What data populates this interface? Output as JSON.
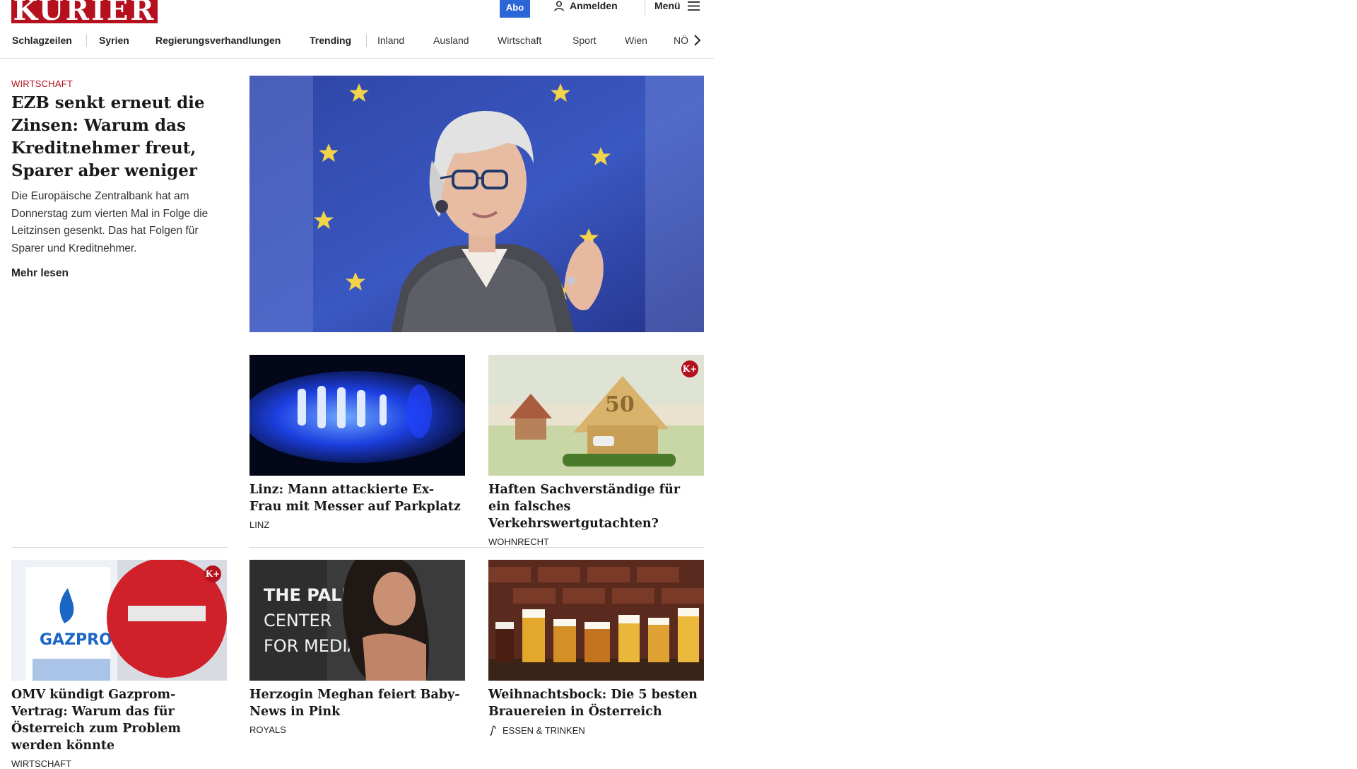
{
  "header": {
    "logo": "KURIER",
    "abo_label": "Abo",
    "login_label": "Anmelden",
    "menu_label": "Menü"
  },
  "nav": {
    "items": [
      {
        "label": "Schlagzeilen"
      },
      {
        "label": "Syrien"
      },
      {
        "label": "Regierungsverhandlungen"
      },
      {
        "label": "Trending"
      },
      {
        "label": "Inland"
      },
      {
        "label": "Ausland"
      },
      {
        "label": "Wirtschaft"
      },
      {
        "label": "Sport"
      },
      {
        "label": "Wien"
      },
      {
        "label": "NÖ"
      }
    ]
  },
  "lead": {
    "kicker": "WIRTSCHAFT",
    "title": "EZB senkt erneut die Zin­sen: Warum das Kredit­nehmer freut, Sparer aber weniger",
    "teaser": "Die Europäische Zentralbank hat am Donnerstag zum vierten Mal in Folge die Leitzinsen gesenkt. Das hat Folgen für Sparer und Kreditnehmer.",
    "more_label": "Mehr lesen"
  },
  "cards": [
    {
      "title": "Linz: Mann attackierte Ex-Frau mit Messer auf Parkplatz",
      "ressort": "LINZ",
      "premium": false
    },
    {
      "title": "Haften Sachverständige für ein fal­sches Verkehrswertgutachten?",
      "ressort": "WOHNRECHT",
      "premium": true
    },
    {
      "title": "OMV kündigt Gazprom-Vertrag: Warum das für Österreich zum Problem werden könnte",
      "ressort": "WIRTSCHAFT",
      "premium": true
    },
    {
      "title": "Herzogin Meghan feiert Baby-News in Pink",
      "ressort": "ROYALS",
      "premium": false
    },
    {
      "title": "Weihnachtsbock: Die 5 besten Brauereien in Österreich",
      "ressort": "ESSEN & TRINKEN",
      "premium": false
    }
  ],
  "badge_label": "K+",
  "image_text": {
    "gazprom": "GAZPROM",
    "paley_1": "THE PALEY",
    "paley_2": "CENTER",
    "paley_3": "FOR MEDIA",
    "banknote": "50"
  },
  "colors": {
    "brand_red": "#b4101e",
    "abo_blue": "#2b66d6"
  }
}
